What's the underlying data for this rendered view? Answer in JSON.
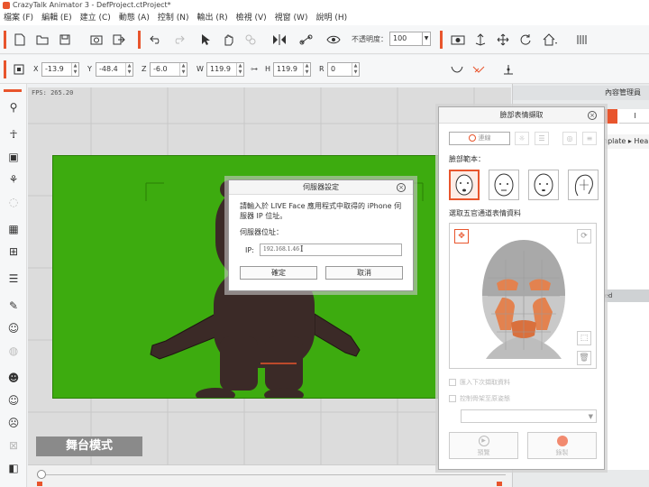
{
  "window": {
    "title": "CrazyTalk Animator 3 - DefProject.ctProject*"
  },
  "menu": [
    "檔案 (F)",
    "編輯 (E)",
    "建立 (C)",
    "動態 (A)",
    "控制 (N)",
    "輸出 (R)",
    "檢視 (V)",
    "視窗 (W)",
    "說明 (H)"
  ],
  "toolbar": {
    "opacity_label": "不透明度：",
    "opacity_value": "100"
  },
  "transform": {
    "x_label": "X",
    "x_value": "-13.9",
    "y_label": "Y",
    "y_value": "-48.4",
    "z_label": "Z",
    "z_value": "-6.0",
    "w_label": "W",
    "w_value": "119.9",
    "h_label": "H",
    "h_value": "119.9",
    "r_label": "R",
    "r_value": "0"
  },
  "stage": {
    "fps": "FPS: 265.20",
    "mode_label": "舞台模式",
    "colors": {
      "green": "#3dab0f",
      "bear": "#3b2a27"
    }
  },
  "content_manager": {
    "title": "內容管理員",
    "tab2": "I",
    "crumb": "nplate ▸ Hea",
    "used_label": "sed"
  },
  "server_dialog": {
    "title": "伺服器設定",
    "message": "請輸入於 LIVE Face 應用程式中取得的 iPhone 伺服器 IP 位址。",
    "ip_section_label": "伺服器位址：",
    "ip_label": "IP:",
    "ip_value": "192.168.1.46",
    "ok_label": "確定",
    "cancel_label": "取消"
  },
  "face_panel": {
    "title": "臉部表情擷取",
    "connect_label": "連線",
    "template_label": "臉部範本：",
    "preview_label": "選取五官通道表情資料",
    "check1": "匯入下次擷取資料",
    "check2": "控制骨架至原姿態",
    "preview_btn": "預覽",
    "record_btn": "錄製",
    "accent": "#e8552d"
  }
}
